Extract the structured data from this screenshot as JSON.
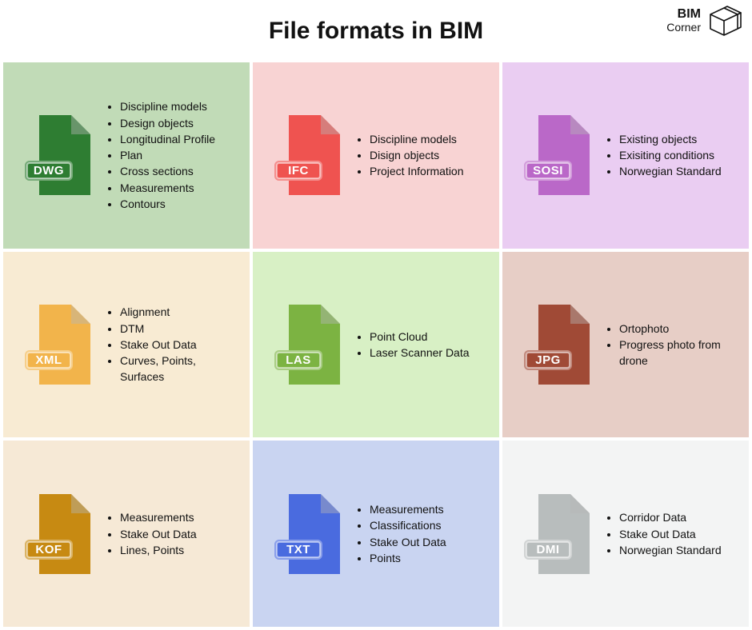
{
  "title": "File formats in BIM",
  "logo": {
    "line1": "BIM",
    "line2": "Corner"
  },
  "cards": [
    {
      "ext": "DWG",
      "bg": "#C1DBB7",
      "iconColor": "#2E7D32",
      "items": [
        "Discipline models",
        "Design objects",
        "Longitudinal Profile",
        "Plan",
        "Cross sections",
        "Measurements",
        "Contours"
      ]
    },
    {
      "ext": "IFC",
      "bg": "#F8D3D3",
      "iconColor": "#EF5350",
      "items": [
        "Discipline models",
        "Disign objects",
        "Project Information"
      ]
    },
    {
      "ext": "SOSI",
      "bg": "#EACDF2",
      "iconColor": "#BA68C8",
      "items": [
        "Existing objects",
        "Exisiting conditions",
        "Norwegian Standard"
      ]
    },
    {
      "ext": "XML",
      "bg": "#F8EBD3",
      "iconColor": "#F2B44B",
      "items": [
        "Alignment",
        "DTM",
        "Stake Out Data",
        "Curves, Points, Surfaces"
      ]
    },
    {
      "ext": "LAS",
      "bg": "#D8F0C5",
      "iconColor": "#7CB342",
      "items": [
        "Point Cloud",
        "Laser Scanner Data"
      ]
    },
    {
      "ext": "JPG",
      "bg": "#E7CEC6",
      "iconColor": "#A04A36",
      "items": [
        "Ortophoto",
        "Progress photo from drone"
      ]
    },
    {
      "ext": "KOF",
      "bg": "#F6E9D6",
      "iconColor": "#C78A12",
      "items": [
        "Measurements",
        "Stake Out Data",
        "Lines, Points"
      ]
    },
    {
      "ext": "TXT",
      "bg": "#C9D4F1",
      "iconColor": "#4A6BDF",
      "items": [
        "Measurements",
        "Classifications",
        "Stake Out Data",
        "Points"
      ]
    },
    {
      "ext": "DMI",
      "bg": "#F3F4F4",
      "iconColor": "#B8BDBD",
      "items": [
        "Corridor Data",
        "Stake Out Data",
        "Norwegian Standard"
      ]
    }
  ]
}
